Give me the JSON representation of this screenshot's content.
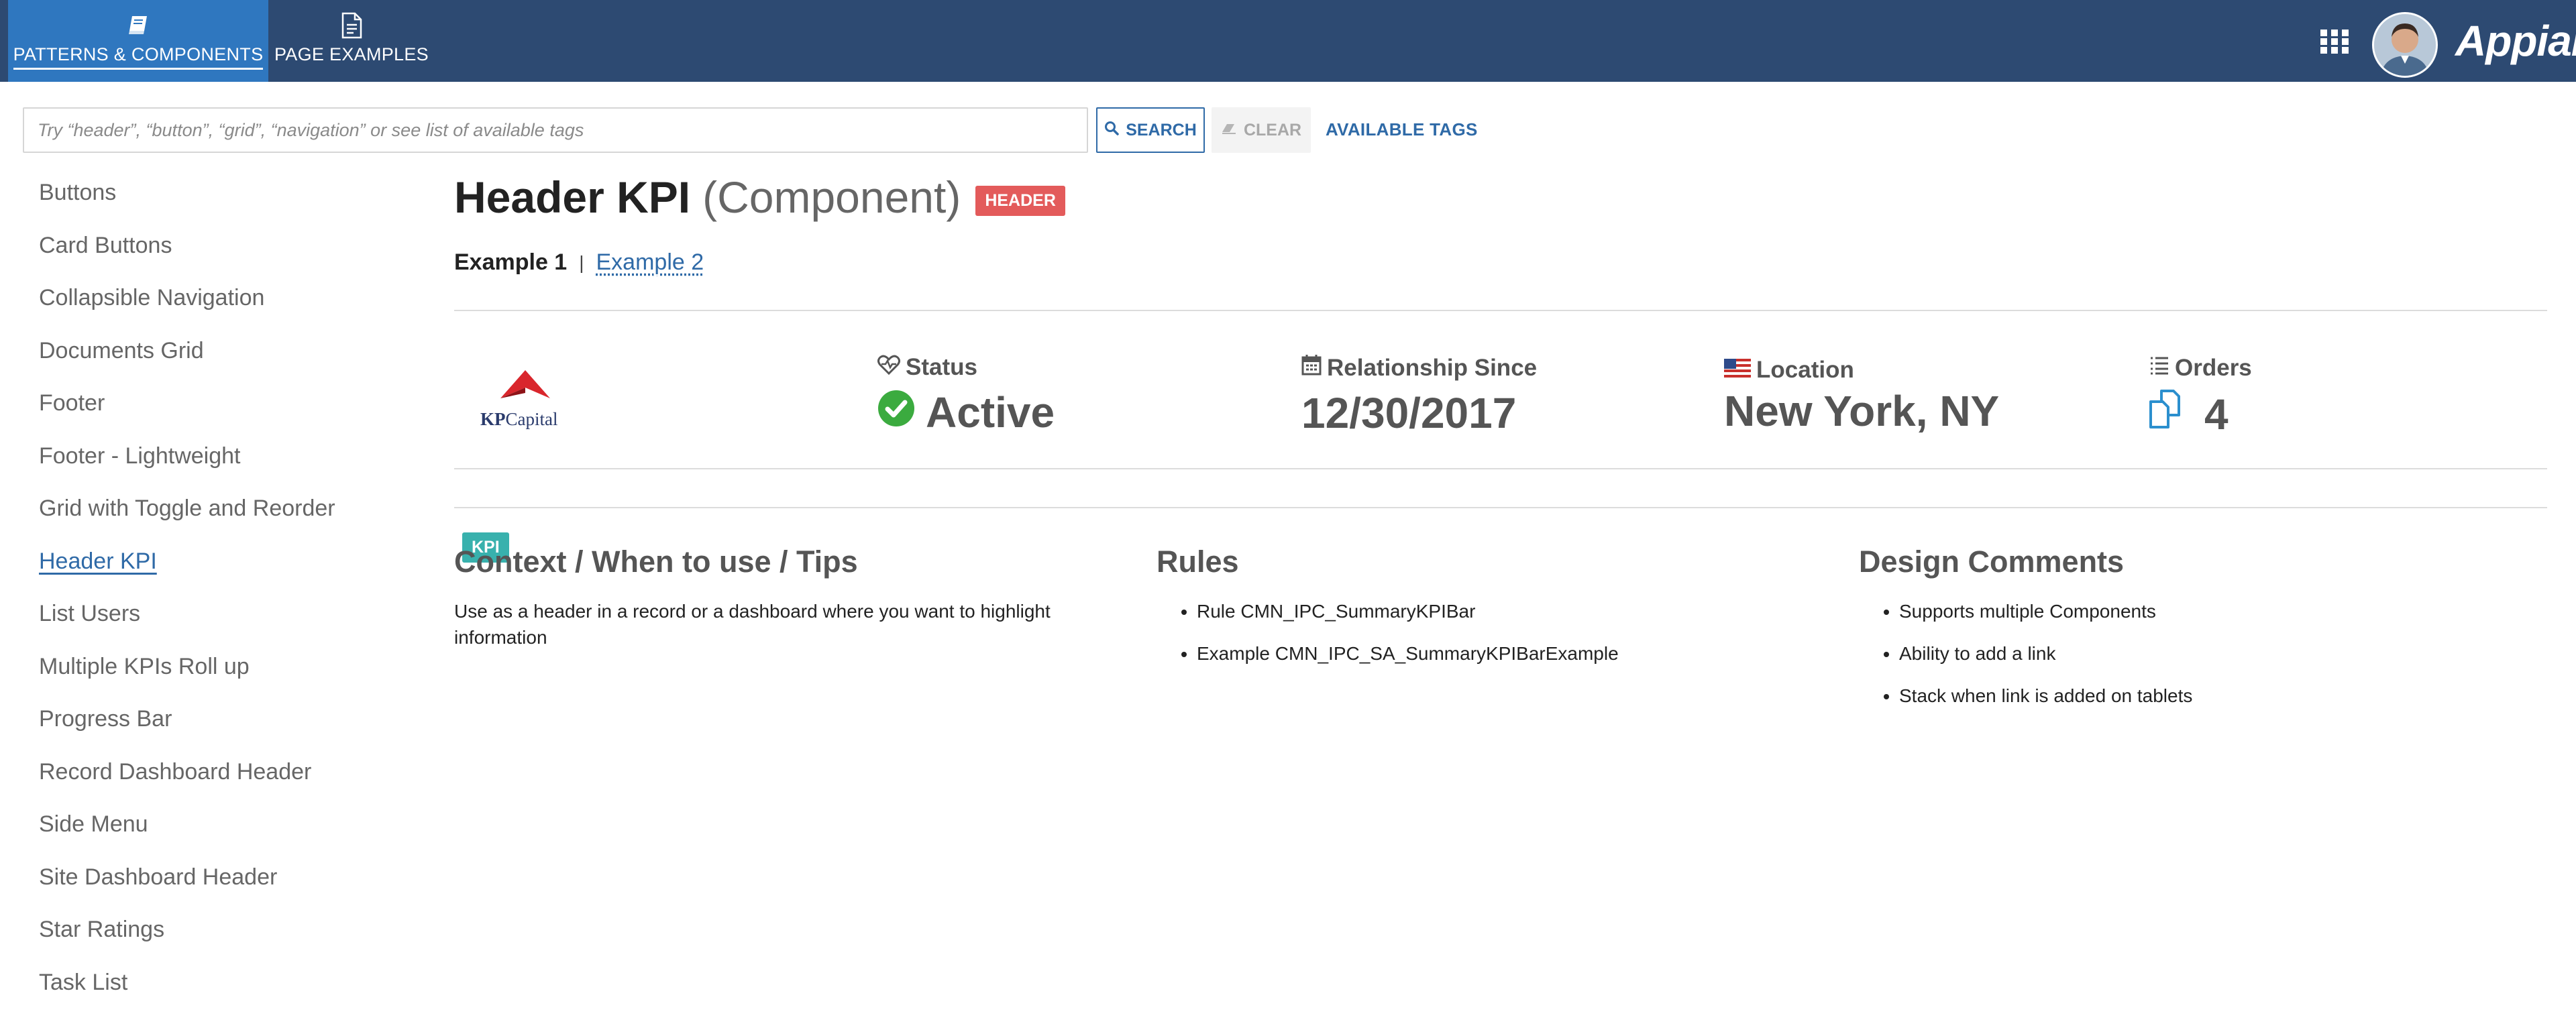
{
  "nav": {
    "tabs": [
      {
        "label": "PATTERNS & COMPONENTS",
        "icon": "book-icon",
        "active": true
      },
      {
        "label": "PAGE EXAMPLES",
        "icon": "document-icon",
        "active": false
      }
    ],
    "brand": "Appian",
    "icons": {
      "apps": "grid-icon",
      "user": "avatar"
    }
  },
  "search": {
    "placeholder": "Try “header”, “button”, “grid”, “navigation” or see list of available tags",
    "value": "",
    "search_label": "SEARCH",
    "clear_label": "CLEAR",
    "tags_label": "AVAILABLE TAGS"
  },
  "sidebar": {
    "items": [
      {
        "label": "Buttons"
      },
      {
        "label": "Card Buttons"
      },
      {
        "label": "Collapsible Navigation"
      },
      {
        "label": "Documents Grid"
      },
      {
        "label": "Footer"
      },
      {
        "label": "Footer - Lightweight"
      },
      {
        "label": "Grid with Toggle and Reorder"
      },
      {
        "label": "Header KPI",
        "active": true
      },
      {
        "label": "List Users"
      },
      {
        "label": "Multiple KPIs Roll up"
      },
      {
        "label": "Progress Bar"
      },
      {
        "label": "Record Dashboard Header"
      },
      {
        "label": "Side Menu"
      },
      {
        "label": "Site Dashboard Header"
      },
      {
        "label": "Star Ratings"
      },
      {
        "label": "Task List"
      }
    ]
  },
  "main": {
    "title": "Header KPI",
    "subtitle": "(Component)",
    "tags": [
      "HEADER",
      "KPI"
    ],
    "example_active": "Example 1",
    "example_separator": "|",
    "example_link": "Example 2",
    "kpi": {
      "logo_kp": "KP",
      "logo_name": "Capital",
      "status_label": "Status",
      "status_value": "Active",
      "since_label": "Relationship Since",
      "since_value": "12/30/2017",
      "location_label": "Location",
      "location_value": "New York, NY",
      "orders_label": "Orders",
      "orders_value": "4"
    },
    "context": {
      "title": "Context / When to use / Tips",
      "text": "Use as a header in a record or a dashboard where you want to highlight information"
    },
    "rules": {
      "title": "Rules",
      "items": [
        "Rule CMN_IPC_SummaryKPIBar",
        "Example CMN_IPC_SA_SummaryKPIBarExample"
      ]
    },
    "design": {
      "title": "Design Comments",
      "items": [
        "Supports multiple Components",
        "Ability to add a link",
        "Stack when link is added on tablets"
      ]
    }
  },
  "colors": {
    "nav_bg": "#2d4a72",
    "nav_active": "#2f77bf",
    "link": "#2f6aa7",
    "badge_header": "#e35b5b",
    "badge_kpi": "#38b1ad",
    "status_green": "#3bab3f",
    "orders_icon": "#2b8fce"
  }
}
